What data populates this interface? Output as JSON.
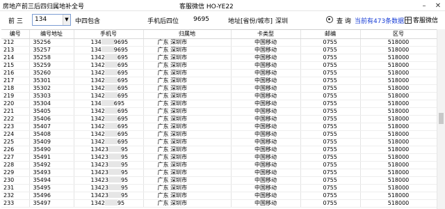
{
  "window": {
    "title": "房地产前三后四归属地补全号",
    "center_text": "客服微信 HO-YE22",
    "minimize": "–",
    "close": "✕"
  },
  "toolbar": {
    "prefix_label": "前 三",
    "prefix_value": "134",
    "mode_label": "中四包含",
    "last4_label": "手机后四位",
    "last4_value": "9695",
    "region_label": "地址[省份/城市]",
    "region_value": "深圳",
    "query_label": "查 询",
    "count_text": "当前有473条数据",
    "wechat_label": "客服微信"
  },
  "table": {
    "columns": [
      "编号",
      "编号地址",
      "手机号",
      "归属地",
      "卡类型",
      "邮编",
      "区号"
    ],
    "rows": [
      [
        "212",
        "35256",
        "134",
        "9695",
        "广东 深圳市",
        "中国移动",
        "0755",
        "518000"
      ],
      [
        "213",
        "35257",
        "134",
        "9695",
        "广东 深圳市",
        "中国移动",
        "0755",
        "518000"
      ],
      [
        "214",
        "35258",
        "1342",
        "695",
        "广东 深圳市",
        "中国移动",
        "0755",
        "518000"
      ],
      [
        "215",
        "35259",
        "1342",
        "695",
        "广东 深圳市",
        "中国移动",
        "0755",
        "518000"
      ],
      [
        "216",
        "35260",
        "1342",
        "695",
        "广东 深圳市",
        "中国移动",
        "0755",
        "518000"
      ],
      [
        "217",
        "35301",
        "1342",
        "695",
        "广东 深圳市",
        "中国移动",
        "0755",
        "518000"
      ],
      [
        "218",
        "35302",
        "1342",
        "695",
        "广东 深圳市",
        "中国移动",
        "0755",
        "518000"
      ],
      [
        "219",
        "35303",
        "1342",
        "695",
        "广东 深圳市",
        "中国移动",
        "0755",
        "518000"
      ],
      [
        "220",
        "35304",
        "134",
        "695",
        "广东 深圳市",
        "中国移动",
        "0755",
        "518000"
      ],
      [
        "221",
        "35405",
        "1342",
        "695",
        "广东 深圳市",
        "中国移动",
        "0755",
        "518000"
      ],
      [
        "222",
        "35406",
        "1342",
        "695",
        "广东 深圳市",
        "中国移动",
        "0755",
        "518000"
      ],
      [
        "223",
        "35407",
        "1342",
        "695",
        "广东 深圳市",
        "中国移动",
        "0755",
        "518000"
      ],
      [
        "224",
        "35408",
        "1342",
        "695",
        "广东 深圳市",
        "中国移动",
        "0755",
        "518000"
      ],
      [
        "225",
        "35409",
        "1342",
        "695",
        "广东 深圳市",
        "中国移动",
        "0755",
        "518000"
      ],
      [
        "226",
        "35490",
        "13423",
        "95",
        "广东 深圳市",
        "中国移动",
        "0755",
        "518000"
      ],
      [
        "227",
        "35491",
        "13423",
        "95",
        "广东 深圳市",
        "中国移动",
        "0755",
        "518000"
      ],
      [
        "228",
        "35492",
        "13423",
        "95",
        "广东 深圳市",
        "中国移动",
        "0755",
        "518000"
      ],
      [
        "229",
        "35493",
        "13423",
        "95",
        "广东 深圳市",
        "中国移动",
        "0755",
        "518000"
      ],
      [
        "230",
        "35494",
        "13423",
        "95",
        "广东 深圳市",
        "中国移动",
        "0755",
        "518000"
      ],
      [
        "231",
        "35495",
        "13423",
        "95",
        "广东 深圳市",
        "中国移动",
        "0755",
        "518000"
      ],
      [
        "232",
        "35496",
        "13423",
        "95",
        "广东 深圳市",
        "中国移动",
        "0755",
        "518000"
      ],
      [
        "233",
        "35497",
        "1342",
        "95",
        "广东 深圳市",
        "中国移动",
        "0755",
        "518000"
      ]
    ]
  }
}
